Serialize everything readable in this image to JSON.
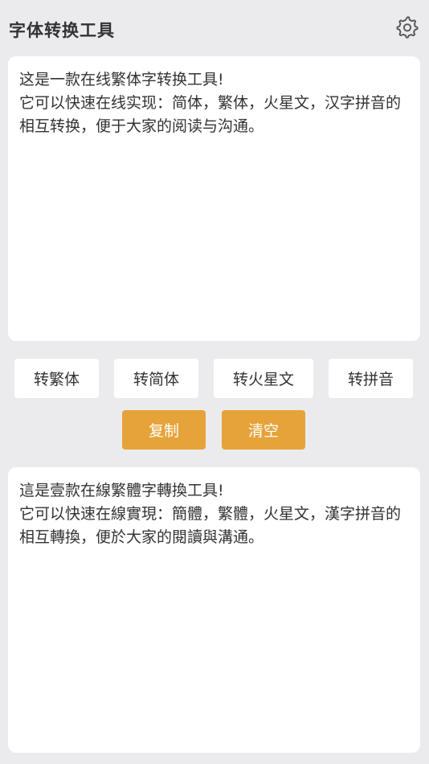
{
  "header": {
    "title": "字体转换工具",
    "settings_icon": "gear-icon"
  },
  "input": {
    "text": "这是一款在线繁体字转换工具!\n它可以快速在线实现：简体，繁体，火星文，汉字拼音的相互转换，便于大家的阅读与沟通。"
  },
  "convert_buttons": {
    "traditional": "转繁体",
    "simplified": "转简体",
    "martian": "转火星文",
    "pinyin": "转拼音"
  },
  "action_buttons": {
    "copy": "复制",
    "clear": "清空"
  },
  "output": {
    "text": "這是壹款在線繁體字轉換工具!\n它可以快速在線實現：簡體，繁體，火星文，漢字拼音的相互轉換，便於大家的閱讀與溝通。"
  },
  "colors": {
    "background": "#ebebed",
    "panel": "#ffffff",
    "accent": "#e6a33a",
    "text": "#333333"
  }
}
